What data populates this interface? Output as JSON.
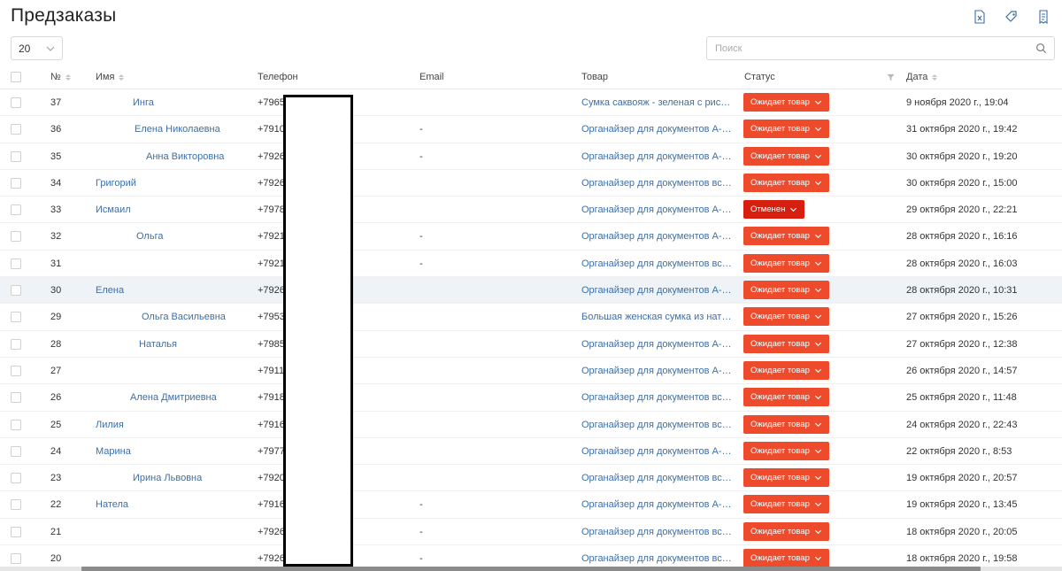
{
  "title": "Предзаказы",
  "toolbar": {
    "page_size": "20",
    "search_placeholder": "Поиск",
    "icons": [
      "export-excel-icon",
      "tag-icon",
      "receipt-icon"
    ]
  },
  "columns": {
    "num": "№",
    "name": "Имя",
    "phone": "Телефон",
    "email": "Email",
    "product": "Товар",
    "status": "Статус",
    "date": "Дата"
  },
  "colors": {
    "status_waiting": "#ee4a2c",
    "status_cancelled": "#d61f0f",
    "link": "#3d6fa8",
    "row_highlight": "#eef3f7"
  },
  "rows": [
    {
      "num": "37",
      "name": "Инга",
      "phone": "+7965",
      "email": "",
      "product": "Сумка саквояж - зеленая с рисун…",
      "status": "Ожидает товар",
      "date": "9 ноября 2020 г., 19:04"
    },
    {
      "num": "36",
      "name": "Елена Николаевна",
      "phone": "+7910",
      "email": "-",
      "product": "Органайзер для документов А-4 /…",
      "status": "Ожидает товар",
      "date": "31 октября 2020 г., 19:42"
    },
    {
      "num": "35",
      "name": "Анна Викторовна",
      "phone": "+7926",
      "email": "-",
      "product": "Органайзер для документов А-4 /…",
      "status": "Ожидает товар",
      "date": "30 октября 2020 г., 19:20"
    },
    {
      "num": "34",
      "name": "Григорий",
      "phone": "+7926",
      "email": "",
      "product": "Органайзер для документов всей…",
      "status": "Ожидает товар",
      "date": "30 октября 2020 г., 15:00"
    },
    {
      "num": "33",
      "name": "Исмаил",
      "phone": "+7978",
      "email": "",
      "product": "Органайзер для документов А-4 /…",
      "status": "Отменен",
      "date": "29 октября 2020 г., 22:21"
    },
    {
      "num": "32",
      "name": "Ольга",
      "phone": "+7921",
      "email": "-",
      "product": "Органайзер для документов А-4 /…",
      "status": "Ожидает товар",
      "date": "28 октября 2020 г., 16:16"
    },
    {
      "num": "31",
      "name": "",
      "phone": "+7921",
      "email": "-",
      "product": "Органайзер для документов всей…",
      "status": "Ожидает товар",
      "date": "28 октября 2020 г., 16:03"
    },
    {
      "num": "30",
      "name": "Елена",
      "phone": "+7926",
      "email": "",
      "product": "Органайзер для документов А-4 /…",
      "status": "Ожидает товар",
      "date": "28 октября 2020 г., 10:31"
    },
    {
      "num": "29",
      "name": "Ольга Васильевна",
      "phone": "+7953",
      "email": "",
      "product": "Большая женская сумка из натур…",
      "status": "Ожидает товар",
      "date": "27 октября 2020 г., 15:26"
    },
    {
      "num": "28",
      "name": "Наталья",
      "phone": "+7985",
      "email": "",
      "product": "Органайзер для документов А-4 /…",
      "status": "Ожидает товар",
      "date": "27 октября 2020 г., 12:38"
    },
    {
      "num": "27",
      "name": "",
      "phone": "+7911",
      "email": "",
      "product": "Органайзер для документов А-4 /…",
      "status": "Ожидает товар",
      "date": "26 октября 2020 г., 14:57"
    },
    {
      "num": "26",
      "name": "Алена Дмитриевна",
      "phone": "+7918",
      "email": "",
      "product": "Органайзер для документов всей…",
      "status": "Ожидает товар",
      "date": "25 октября 2020 г., 11:48"
    },
    {
      "num": "25",
      "name": "Лилия",
      "phone": "+7916",
      "email": "",
      "product": "Органайзер для документов всей…",
      "status": "Ожидает товар",
      "date": "24 октября 2020 г., 22:43"
    },
    {
      "num": "24",
      "name": "Марина",
      "phone": "+7977",
      "email": "",
      "product": "Органайзер для документов А-4 /…",
      "status": "Ожидает товар",
      "date": "22 октября 2020 г., 8:53"
    },
    {
      "num": "23",
      "name": "Ирина Львовна",
      "phone": "+7920",
      "email": "",
      "product": "Органайзер для документов всей…",
      "status": "Ожидает товар",
      "date": "19 октября 2020 г., 20:57"
    },
    {
      "num": "22",
      "name": "Натела",
      "phone": "+7916",
      "email": "-",
      "product": "Органайзер для документов А-4 /…",
      "status": "Ожидает товар",
      "date": "19 октября 2020 г., 13:45"
    },
    {
      "num": "21",
      "name": "",
      "phone": "+7926",
      "email": "-",
      "product": "Органайзер для документов всей…",
      "status": "Ожидает товар",
      "date": "18 октября 2020 г., 20:05"
    },
    {
      "num": "20",
      "name": "",
      "phone": "+7926",
      "email": "-",
      "product": "Органайзер для документов всей…",
      "status": "Ожидает товар",
      "date": "18 октября 2020 г., 19:58"
    }
  ]
}
